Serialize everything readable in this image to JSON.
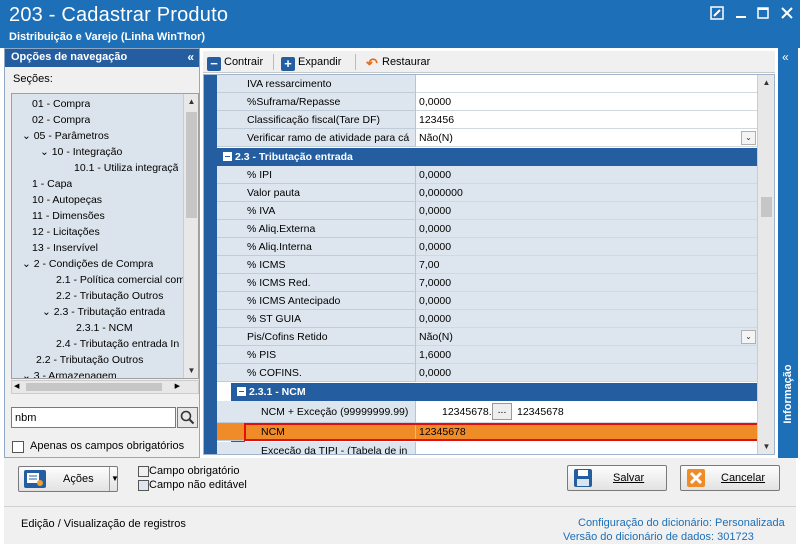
{
  "window": {
    "title": "203 - Cadastrar  Produto",
    "subtitle": "Distribuição e Varejo (Linha WinThor)"
  },
  "nav": {
    "header": "Opções de navegação",
    "sections_label": "Seções:",
    "tree": [
      {
        "label": "01 - Compra"
      },
      {
        "label": "02 - Compra"
      },
      {
        "label": "05 - Parâmetros"
      },
      {
        "label": "10 - Integração"
      },
      {
        "label": "10.1 - Utiliza integraçã"
      },
      {
        "label": "1 - Capa"
      },
      {
        "label": "10 - Autopeças"
      },
      {
        "label": "11 - Dimensões"
      },
      {
        "label": "12 - Licitações"
      },
      {
        "label": "13 - Inservível"
      },
      {
        "label": "2 - Condições de Compra"
      },
      {
        "label": "2.1 - Política comercial com"
      },
      {
        "label": "2.2 - Tributação Outros"
      },
      {
        "label": "2.3 - Tributação entrada"
      },
      {
        "label": "2.3.1 - NCM"
      },
      {
        "label": "2.4 - Tributação entrada In"
      },
      {
        "label": "2.2 - Tributação Outros"
      },
      {
        "label": "3 - Armazenagem"
      }
    ],
    "search_value": "nbm",
    "only_required_label": "Apenas os campos obrigatórios"
  },
  "toolbar": {
    "collapse": "Contrair",
    "expand": "Expandir",
    "restore": "Restaurar"
  },
  "grid": {
    "rows_top": [
      {
        "label": "IVA ressarcimento",
        "value": ""
      },
      {
        "label": "%Suframa/Repasse",
        "value": "0,0000"
      },
      {
        "label": "Classificação fiscal(Tare DF)",
        "value": "123456"
      },
      {
        "label": "Verificar ramo de atividade para cá",
        "value": "Não(N)"
      }
    ],
    "group1": "2.3 - Tributação entrada",
    "rows_group1": [
      {
        "label": "% IPI",
        "value": "0,0000"
      },
      {
        "label": "Valor pauta",
        "value": "0,000000"
      },
      {
        "label": "% IVA",
        "value": "0,0000"
      },
      {
        "label": "% Aliq.Externa",
        "value": "0,0000"
      },
      {
        "label": "% Aliq.Interna",
        "value": "0,0000"
      },
      {
        "label": "% ICMS",
        "value": "7,00"
      },
      {
        "label": "% ICMS Red.",
        "value": "7,0000"
      },
      {
        "label": "% ICMS Antecipado",
        "value": "0,0000"
      },
      {
        "label": "% ST GUIA",
        "value": "0,0000"
      },
      {
        "label": "Pis/Cofins Retido",
        "value": "Não(N)"
      },
      {
        "label": "% PIS",
        "value": "1,6000"
      },
      {
        "label": "% COFINS.",
        "value": "0,0000"
      }
    ],
    "group2": "2.3.1 - NCM",
    "ncm_exc_label": "NCM + Exceção (99999999.99)",
    "ncm_exc_value": "12345678.",
    "ncm_exc_btn": "...",
    "ncm_exc_value2": "12345678",
    "ncm_label": "NCM",
    "ncm_value": "12345678",
    "tipi_label": "Exceção da TIPI - (Tabela de in"
  },
  "info_strip": "Informação",
  "bottom": {
    "actions": "Ações",
    "legend_required": "Campo obrigatório",
    "legend_not_editable": "Campo não editável",
    "save": "Salvar",
    "cancel": "Cancelar",
    "status_left": "Edição / Visualização de registros",
    "dict_config_label": "Configuração do dicionário:",
    "dict_config_value": "Personalizada",
    "dict_version_label": "Versão do dicionário de dados:",
    "dict_version_value": "301723"
  },
  "colors": {
    "title_blue": "#1d6fb8",
    "group_blue": "#245ea0",
    "ncm_orange": "#f08c28",
    "highlight_red": "#e01010"
  }
}
